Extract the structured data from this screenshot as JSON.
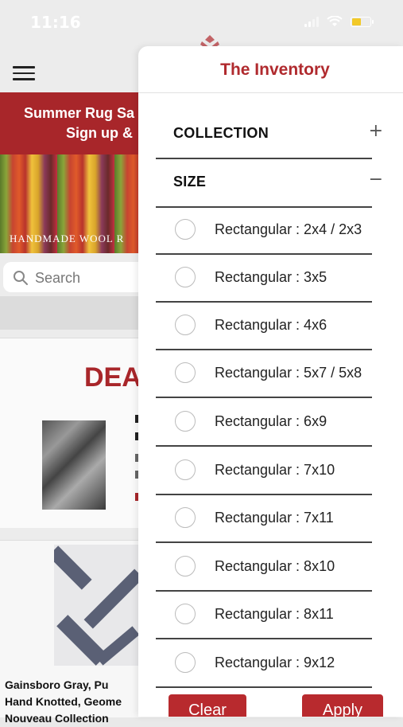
{
  "status": {
    "time": "11:16"
  },
  "page": {
    "promo_line1": "Summer Rug Sa",
    "promo_line2": "Sign up &",
    "banner_caption": "HANDMADE WOOL R",
    "search_placeholder": "Search",
    "deals_title": "DEA",
    "product_lines": [
      "Gainsboro Gray, Pu",
      "Hand Knotted, Geome",
      "Nouveau Collection"
    ],
    "colors": {
      "brand_red": "#a8262a"
    }
  },
  "drawer": {
    "title": "The Inventory",
    "sections": [
      {
        "label": "COLLECTION",
        "toggle": "+"
      },
      {
        "label": "SIZE",
        "toggle": "−"
      }
    ],
    "size_options": [
      "Rectangular : 2x4 / 2x3",
      "Rectangular : 3x5",
      "Rectangular : 4x6",
      "Rectangular : 5x7 / 5x8",
      "Rectangular : 6x9",
      "Rectangular : 7x10",
      "Rectangular : 7x11",
      "Rectangular : 8x10",
      "Rectangular : 8x11",
      "Rectangular : 9x12"
    ],
    "buttons": {
      "clear": "Clear",
      "apply": "Apply"
    }
  }
}
